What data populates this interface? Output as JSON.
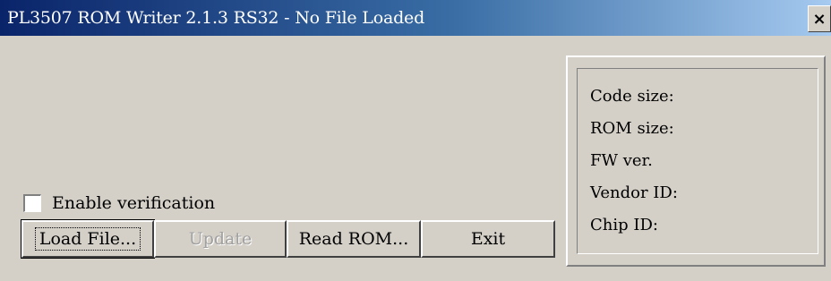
{
  "window": {
    "title": "PL3507  ROM Writer 2.1.3 RS32 - No File Loaded",
    "close_glyph": "×"
  },
  "info": {
    "code_size": "Code size:",
    "rom_size": "ROM size:",
    "fw_ver": "FW ver.",
    "vendor_id": "Vendor ID:",
    "chip_id": "Chip ID:"
  },
  "options": {
    "enable_verification": "Enable verification",
    "enable_verification_checked": false
  },
  "buttons": {
    "load_file": "Load File...",
    "update": "Update",
    "read_rom": "Read ROM...",
    "exit": "Exit"
  }
}
